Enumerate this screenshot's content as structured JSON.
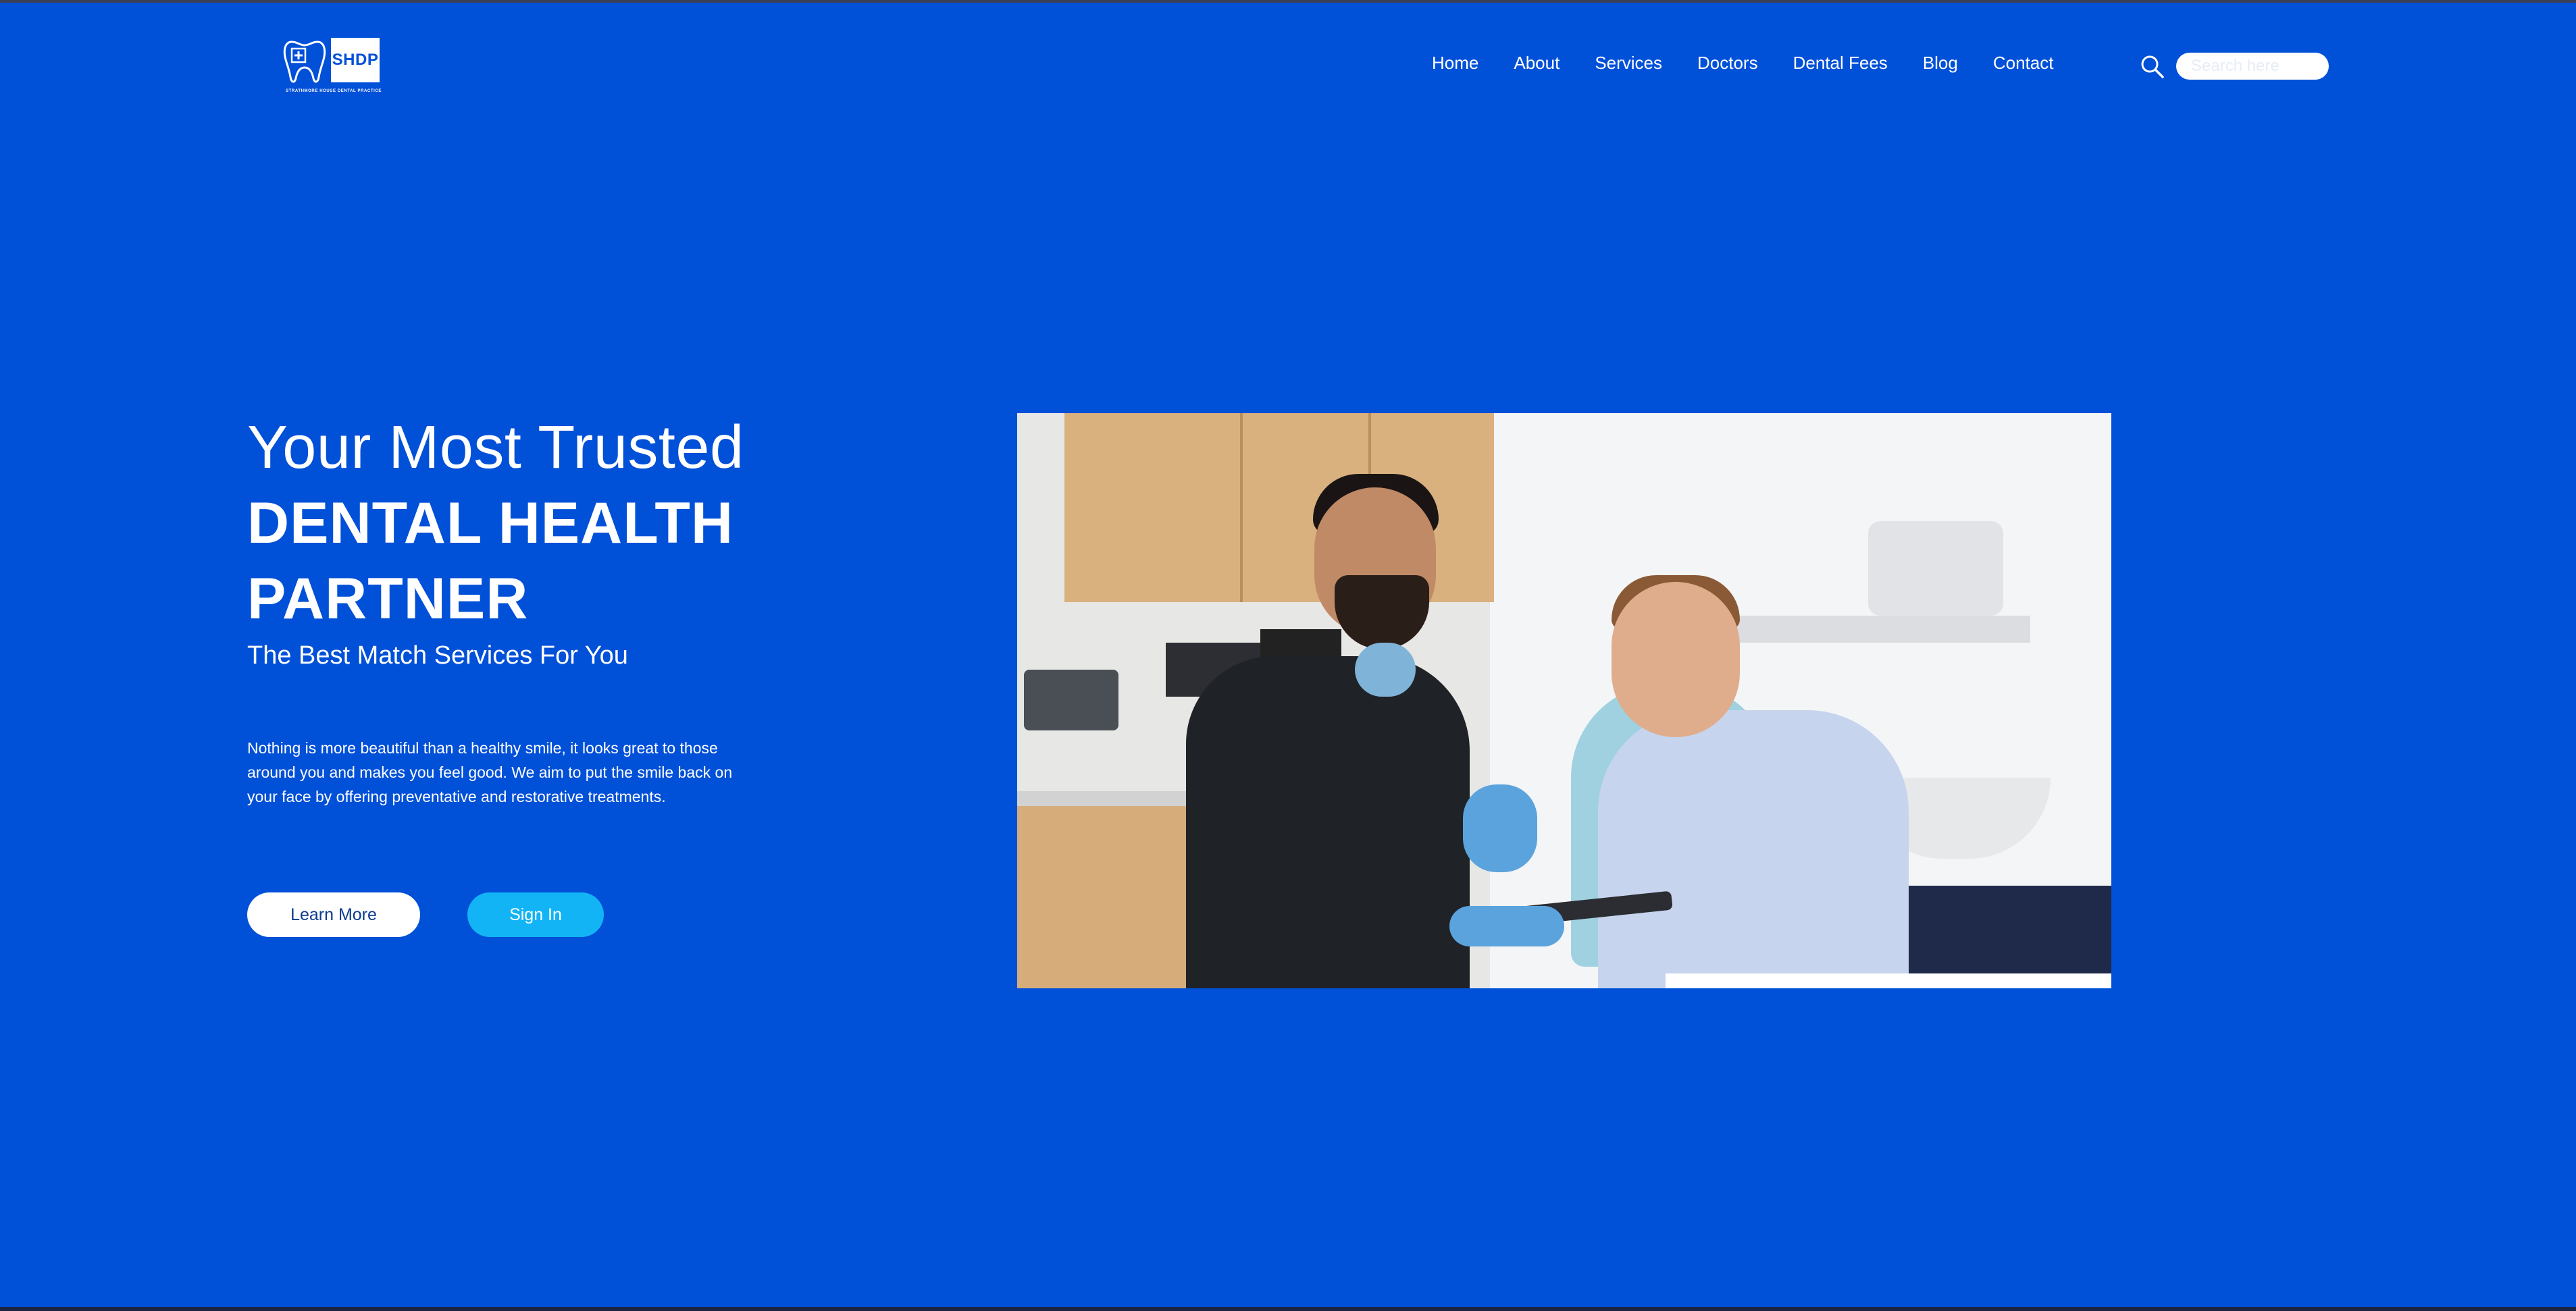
{
  "header": {
    "logo": {
      "badge_text": "SHDP",
      "tagline": "STRATHMORE HOUSE DENTAL PRACTICE"
    },
    "nav": [
      {
        "label": "Home"
      },
      {
        "label": "About"
      },
      {
        "label": "Services"
      },
      {
        "label": "Doctors"
      },
      {
        "label": "Dental Fees"
      },
      {
        "label": "Blog"
      },
      {
        "label": "Contact"
      }
    ],
    "search": {
      "placeholder": "Search here",
      "value": "",
      "icon": "search-icon"
    }
  },
  "hero": {
    "heading_light": "Your Most Trusted",
    "heading_bold_line1": "DENTAL HEALTH",
    "heading_bold_line2": "PARTNER",
    "subheading": "The Best Match Services For You",
    "body": "Nothing is more beautiful than a healthy smile, it looks great to those around you and makes you feel good. We aim to put the smile back on your face by offering preventative and restorative treatments.",
    "buttons": {
      "learn_more": "Learn More",
      "sign_in": "Sign In"
    },
    "image_alt": "Dentist showing a tablet to a smiling patient in a dental chair"
  },
  "colors": {
    "background": "#0050d8",
    "primary_button": "#ffffff",
    "accent_button": "#12b4f5",
    "text": "#ffffff"
  }
}
